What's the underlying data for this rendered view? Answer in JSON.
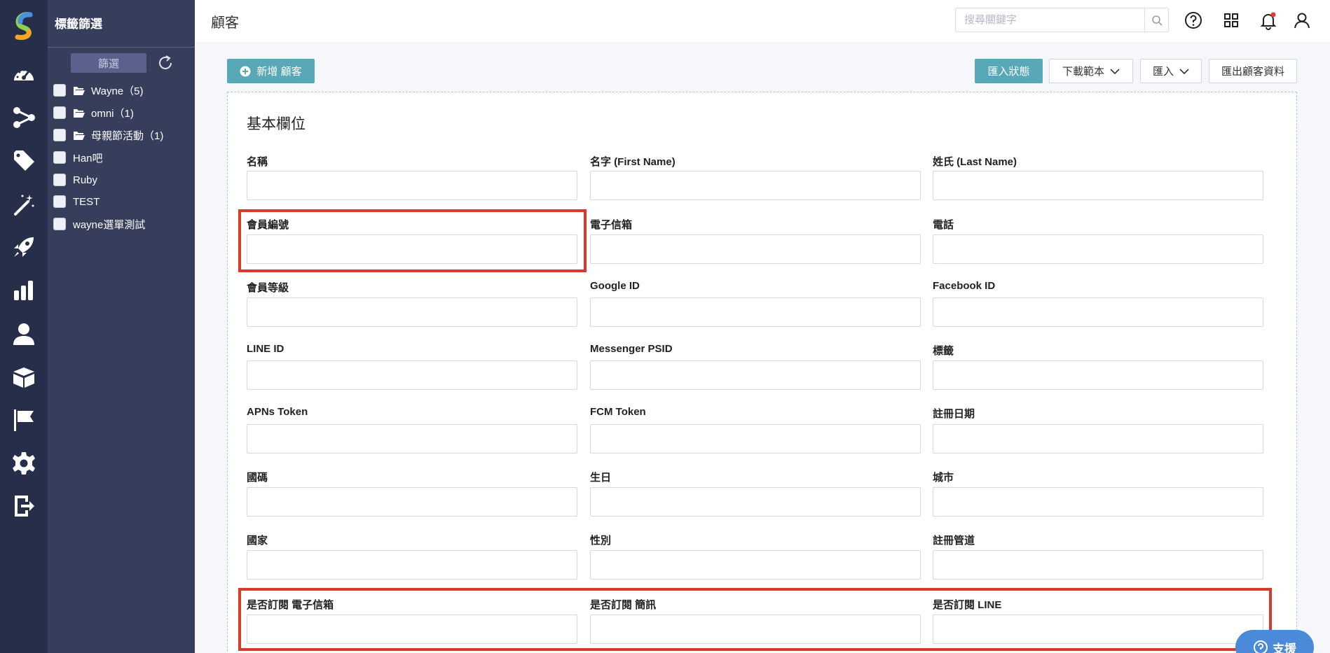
{
  "rail": {
    "items": [
      {
        "icon": "dashboard-icon"
      },
      {
        "icon": "flow-icon"
      },
      {
        "icon": "tag-icon"
      },
      {
        "icon": "magic-wand-icon"
      },
      {
        "icon": "rocket-icon"
      },
      {
        "icon": "bar-chart-icon"
      },
      {
        "icon": "user-icon"
      },
      {
        "icon": "box-icon"
      },
      {
        "icon": "flag-icon"
      },
      {
        "icon": "gear-icon"
      },
      {
        "icon": "logout-icon"
      }
    ]
  },
  "tag_panel": {
    "title": "標籤篩選",
    "filter_label": "篩選",
    "tags": [
      {
        "label": "Wayne（5)",
        "folder": true
      },
      {
        "label": "omni（1)",
        "folder": true
      },
      {
        "label": "母親節活動（1)",
        "folder": true
      },
      {
        "label": "Han吧",
        "folder": false
      },
      {
        "label": "Ruby",
        "folder": false
      },
      {
        "label": "TEST",
        "folder": false
      },
      {
        "label": "wayne選單測試",
        "folder": false
      }
    ]
  },
  "header": {
    "title": "顧客",
    "search_placeholder": "搜尋關鍵字"
  },
  "toolbar": {
    "add_customer": "新增 顧客",
    "import_status": "匯入狀態",
    "download_template": "下載範本",
    "import": "匯入",
    "export": "匯出顧客資料"
  },
  "form": {
    "section_title": "基本欄位",
    "fields": [
      {
        "label": "名稱",
        "value": ""
      },
      {
        "label": "名字 (First Name)",
        "value": ""
      },
      {
        "label": "姓氏 (Last Name)",
        "value": ""
      },
      {
        "label": "會員編號",
        "value": ""
      },
      {
        "label": "電子信箱",
        "value": ""
      },
      {
        "label": "電話",
        "value": ""
      },
      {
        "label": "會員等級",
        "value": ""
      },
      {
        "label": "Google ID",
        "value": ""
      },
      {
        "label": "Facebook ID",
        "value": ""
      },
      {
        "label": "LINE ID",
        "value": ""
      },
      {
        "label": "Messenger PSID",
        "value": ""
      },
      {
        "label": "標籤",
        "value": ""
      },
      {
        "label": "APNs Token",
        "value": ""
      },
      {
        "label": "FCM Token",
        "value": ""
      },
      {
        "label": "註冊日期",
        "value": ""
      },
      {
        "label": "國碼",
        "value": ""
      },
      {
        "label": "生日",
        "value": ""
      },
      {
        "label": "城市",
        "value": ""
      },
      {
        "label": "國家",
        "value": ""
      },
      {
        "label": "性別",
        "value": ""
      },
      {
        "label": "註冊管道",
        "value": ""
      },
      {
        "label": "是否訂閱 電子信箱",
        "value": ""
      },
      {
        "label": "是否訂閱 簡訊",
        "value": ""
      },
      {
        "label": "是否訂閱 LINE",
        "value": ""
      }
    ]
  },
  "support": {
    "label": "支援"
  },
  "colors": {
    "rail_bg": "#262e49",
    "panel_bg": "#363e5b",
    "accent": "#58a8b8",
    "highlight": "#d83a2c",
    "support": "#4a8ad9",
    "notification_dot": "#e53935"
  }
}
